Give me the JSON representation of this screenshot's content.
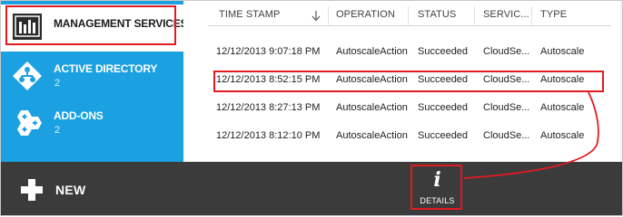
{
  "sidebar": {
    "items": [
      {
        "label": "MANAGEMENT SERVICES",
        "count": "",
        "icon": "management-services-icon",
        "selected": true
      },
      {
        "label": "ACTIVE DIRECTORY",
        "count": "2",
        "icon": "active-directory-icon",
        "selected": false
      },
      {
        "label": "ADD-ONS",
        "count": "2",
        "icon": "add-ons-icon",
        "selected": false
      }
    ]
  },
  "table": {
    "columns": [
      "TIME STAMP",
      "OPERATION",
      "STATUS",
      "SERVIC...",
      "TYPE"
    ],
    "rows": [
      [
        "12/12/2013 9:07:18 PM",
        "AutoscaleAction",
        "Succeeded",
        "CloudSe...",
        "Autoscale"
      ],
      [
        "12/12/2013 8:52:15 PM",
        "AutoscaleAction",
        "Succeeded",
        "CloudSe...",
        "Autoscale"
      ],
      [
        "12/12/2013 8:27:13 PM",
        "AutoscaleAction",
        "Succeeded",
        "CloudSe...",
        "Autoscale"
      ],
      [
        "12/12/2013 8:12:10 PM",
        "AutoscaleAction",
        "Succeeded",
        "CloudSe...",
        "Autoscale"
      ]
    ]
  },
  "commandbar": {
    "new_label": "NEW",
    "details_glyph": "i",
    "details_label": "DETAILS"
  },
  "colors": {
    "sidebar_blue": "#1ba1e2",
    "command_bar": "#3b3b3b",
    "annotation_red": "#e11b22"
  }
}
